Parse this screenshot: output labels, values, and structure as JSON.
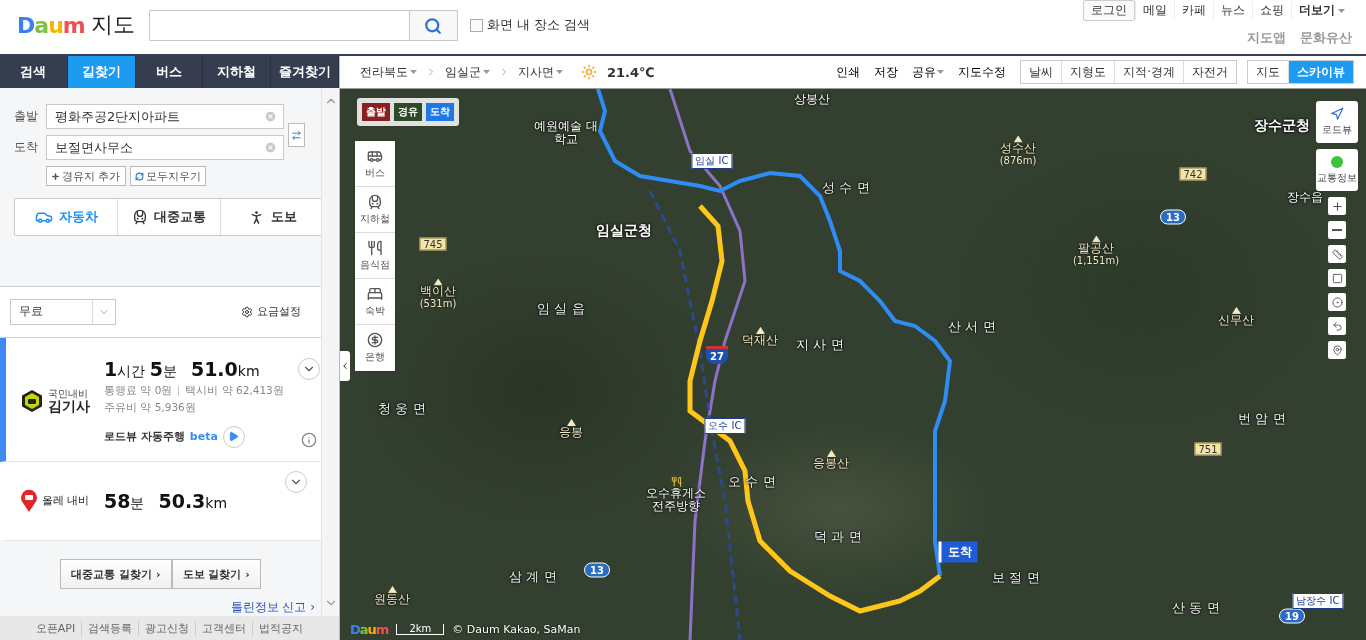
{
  "header": {
    "logo": "Daum",
    "title": "지도",
    "scope_checkbox": {
      "label": "화면 내 장소 검색",
      "checked": false
    },
    "top_links": [
      {
        "label": "로그인",
        "kind": "boxed"
      },
      {
        "label": "메일",
        "kind": "plain"
      },
      {
        "label": "카페",
        "kind": "plain"
      },
      {
        "label": "뉴스",
        "kind": "plain"
      },
      {
        "label": "쇼핑",
        "kind": "plain"
      },
      {
        "label": "더보기",
        "kind": "menu"
      }
    ],
    "sub_links": [
      "지도앱",
      "문화유산"
    ]
  },
  "tabs": [
    {
      "label": "검색",
      "selected": false
    },
    {
      "label": "길찾기",
      "selected": true
    },
    {
      "label": "버스",
      "selected": false
    },
    {
      "label": "지하철",
      "selected": false
    },
    {
      "label": "즐겨찾기",
      "selected": false
    }
  ],
  "route_form": {
    "start": {
      "label": "출발",
      "value": "평화주공2단지아파트"
    },
    "end": {
      "label": "도착",
      "value": "보절면사무소"
    },
    "add_waypoint": "경유지 추가",
    "clear_all": "모두지우기",
    "modes": [
      {
        "label": "자동차",
        "kind": "car",
        "selected": true
      },
      {
        "label": "대중교통",
        "kind": "transit",
        "selected": false
      },
      {
        "label": "도보",
        "kind": "walk",
        "selected": false
      }
    ]
  },
  "fare": {
    "value": "무료",
    "settings": "요금설정"
  },
  "results": [
    {
      "kind": "kimgisa",
      "selected": true,
      "provider_top": "국민내비",
      "provider": "김기사",
      "time": "1시간 5분",
      "distance": "51.0km",
      "toll_label": "통행료",
      "toll": "약 0원",
      "taxi_label": "택시비",
      "taxi": "약 62,413원",
      "fuel_label": "주유비",
      "fuel": "약 5,936원",
      "roadview": "로드뷰 자동주행",
      "badge": "beta"
    },
    {
      "kind": "olleh",
      "selected": false,
      "provider": "올레 내비",
      "time": "58분",
      "distance": "50.3km"
    }
  ],
  "bottom_buttons": [
    "대중교통 길찾기 ›",
    "도보 길찾기 ›"
  ],
  "report_link": "틀린정보 신고 ›",
  "footer_links": [
    "오픈API",
    "검색등록",
    "광고신청",
    "고객센터",
    "법적공지"
  ],
  "map_toolbar": {
    "breadcrumbs": [
      "전라북도",
      "임실군",
      "지사면"
    ],
    "weather": "21.4℃",
    "actions": [
      {
        "label": "인쇄",
        "menu": false
      },
      {
        "label": "저장",
        "menu": false
      },
      {
        "label": "공유",
        "menu": true
      },
      {
        "label": "지도수정",
        "menu": false
      }
    ],
    "layers": [
      "날씨",
      "지형도",
      "지적·경계",
      "자전거"
    ],
    "map_types": [
      {
        "label": "지도",
        "selected": false
      },
      {
        "label": "스카이뷰",
        "selected": true
      }
    ]
  },
  "map": {
    "markers": [
      {
        "label": "출발",
        "color": "#8a1f1f"
      },
      {
        "label": "경유",
        "color": "#2f4a2a"
      },
      {
        "label": "도착",
        "color": "#1e78e6"
      }
    ],
    "categories": [
      {
        "label": "버스",
        "kind": "bus"
      },
      {
        "label": "지하철",
        "kind": "subway"
      },
      {
        "label": "음식점",
        "kind": "food"
      },
      {
        "label": "숙박",
        "kind": "bed"
      },
      {
        "label": "은행",
        "kind": "bank"
      }
    ],
    "controls": [
      {
        "label": "로드뷰",
        "kind": "roadview"
      },
      {
        "label": "교통정보",
        "kind": "traffic"
      }
    ],
    "labels": [
      {
        "text": "상봉산",
        "kind": "place"
      },
      {
        "text": "예원예술 대학교",
        "kind": "school"
      },
      {
        "text": "임실 IC",
        "kind": "ic"
      },
      {
        "text": "성수산",
        "sub": "(876m)",
        "kind": "mountain"
      },
      {
        "text": "장수군청",
        "kind": "city"
      },
      {
        "text": "742",
        "kind": "road"
      },
      {
        "text": "성 수 면",
        "kind": "area"
      },
      {
        "text": "장수읍",
        "kind": "place"
      },
      {
        "text": "임실군청",
        "kind": "city"
      },
      {
        "text": "팔공산",
        "sub": "(1,151m)",
        "kind": "mountain"
      },
      {
        "text": "13",
        "kind": "shield"
      },
      {
        "text": "745",
        "kind": "road"
      },
      {
        "text": "백이산",
        "sub": "(531m)",
        "kind": "mountain"
      },
      {
        "text": "임 실 읍",
        "kind": "area"
      },
      {
        "text": "신무산",
        "kind": "mountain"
      },
      {
        "text": "산 서 면",
        "kind": "area"
      },
      {
        "text": "덕재산",
        "kind": "mountain"
      },
      {
        "text": "27",
        "kind": "highway"
      },
      {
        "text": "지 사 면",
        "kind": "area"
      },
      {
        "text": "청 웅 면",
        "kind": "area"
      },
      {
        "text": "응봉",
        "kind": "mountain"
      },
      {
        "text": "오수 IC",
        "kind": "ic"
      },
      {
        "text": "번 암 면",
        "kind": "area"
      },
      {
        "text": "751",
        "kind": "road"
      },
      {
        "text": "응봉산",
        "kind": "mountain"
      },
      {
        "text": "오 수 면",
        "kind": "area"
      },
      {
        "text": "오수휴게소 전주방향",
        "kind": "rest"
      },
      {
        "text": "덕 과 면",
        "kind": "area"
      },
      {
        "text": "도착",
        "kind": "flag"
      },
      {
        "text": "13",
        "kind": "shield"
      },
      {
        "text": "삼 계 면",
        "kind": "area"
      },
      {
        "text": "보 절 면",
        "kind": "area"
      },
      {
        "text": "원동산",
        "kind": "mountain"
      },
      {
        "text": "산 동 면",
        "kind": "area"
      },
      {
        "text": "19",
        "kind": "shield"
      },
      {
        "text": "남장수 IC",
        "kind": "ic"
      }
    ],
    "attribution": {
      "logo": "Daum",
      "scale": "2km",
      "copyright": "© Daum Kakao, SaMan"
    }
  }
}
